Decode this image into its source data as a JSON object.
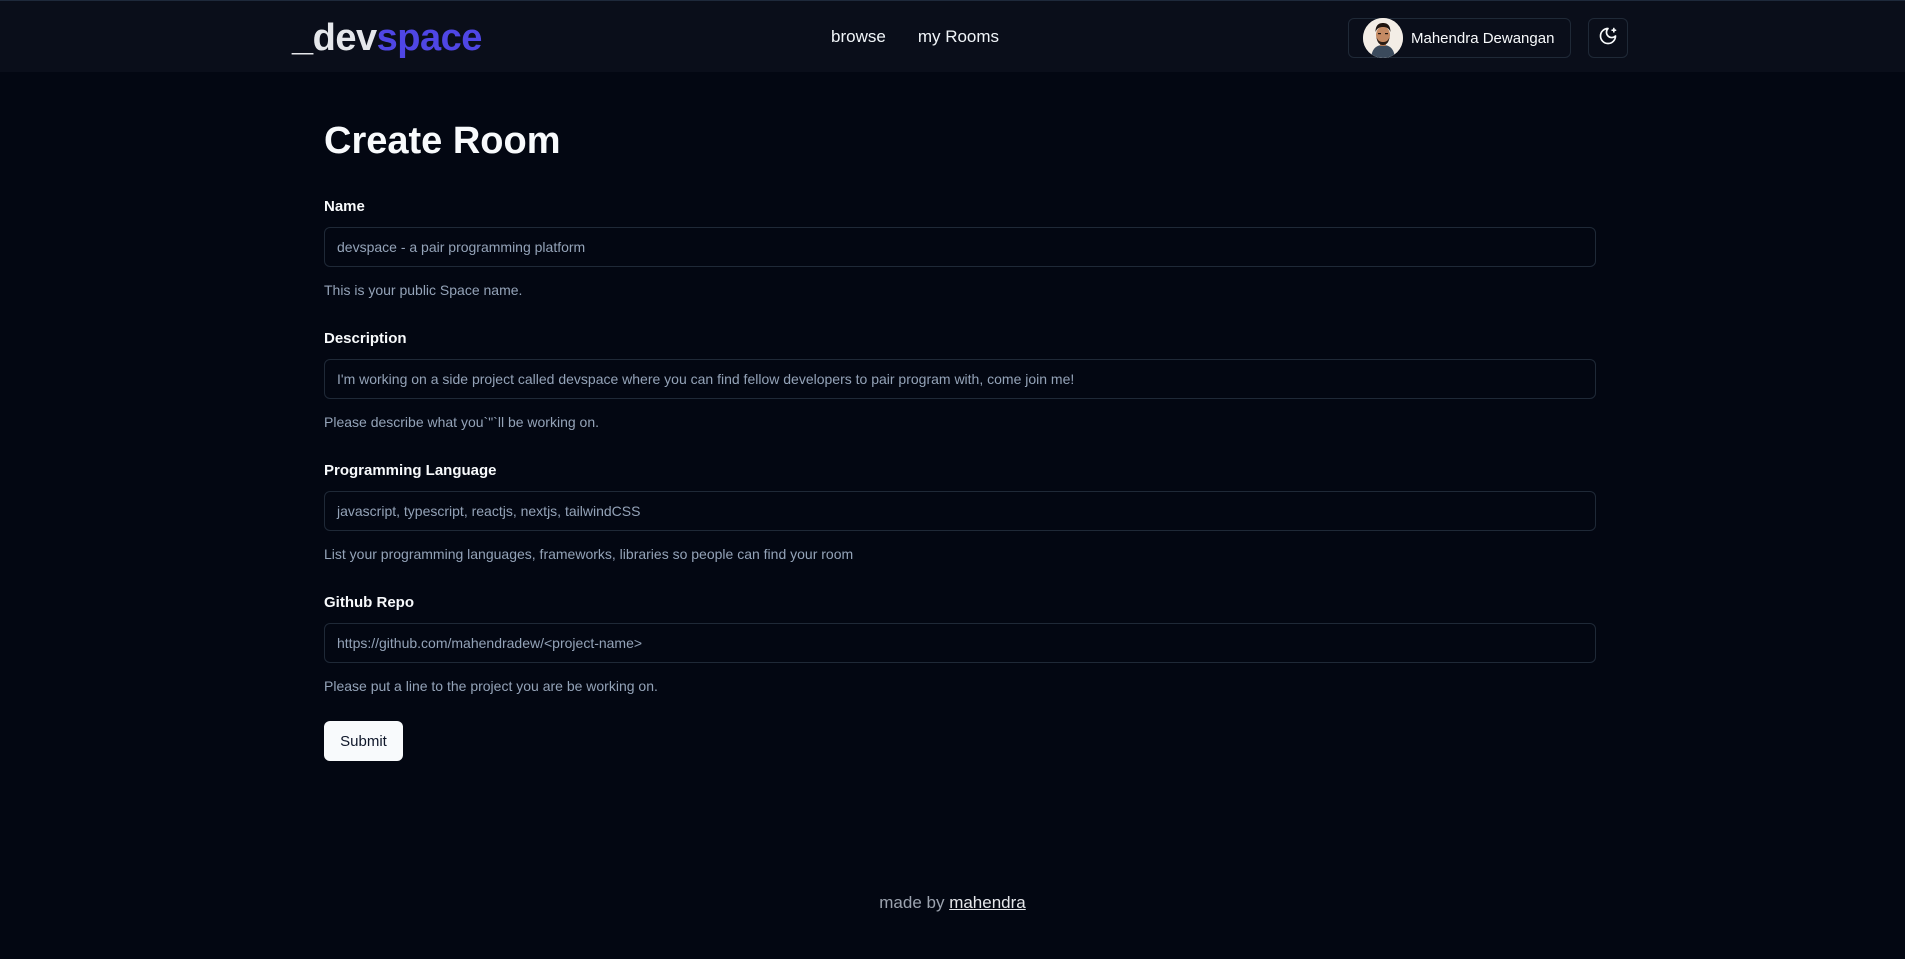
{
  "header": {
    "logo_part1": "_dev",
    "logo_part2": "space",
    "nav": {
      "browse": "browse",
      "my_rooms": "my Rooms"
    },
    "user": {
      "name": "Mahendra Dewangan",
      "avatar_icon": "user-avatar"
    },
    "theme_icon": "moon-stars-icon"
  },
  "page": {
    "title": "Create Room"
  },
  "form": {
    "name": {
      "label": "Name",
      "value": "devspace - a pair programming platform",
      "hint": "This is your public Space name."
    },
    "description": {
      "label": "Description",
      "value": "I'm working on a side project called devspace where you can find fellow developers to pair program with, come join me!",
      "hint": "Please describe what you`\"`ll be working on."
    },
    "language": {
      "label": "Programming Language",
      "value": "javascript, typescript, reactjs, nextjs, tailwindCSS",
      "hint": "List your programming languages, frameworks, libraries so people can find your room"
    },
    "github": {
      "label": "Github Repo",
      "value": "https://github.com/mahendradew/<project-name>",
      "hint": "Please put a line to the project you are be working on."
    },
    "submit_label": "Submit"
  },
  "footer": {
    "text": "made by",
    "link": "mahendra"
  },
  "colors": {
    "background": "#030712",
    "header_bg": "#0a0e1a",
    "accent": "#4f46e5",
    "muted_text": "#94a3b8"
  }
}
